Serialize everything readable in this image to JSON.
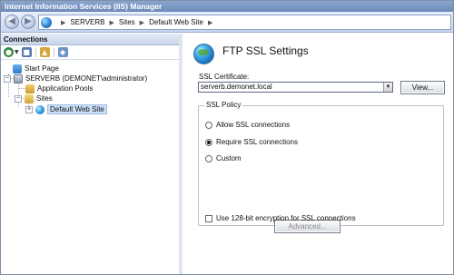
{
  "window": {
    "title": "Internet Information Services (IIS) Manager"
  },
  "addressbar": {
    "back_glyph": "◀",
    "forward_glyph": "▶",
    "crumbs": [
      "SERVERB",
      "Sites",
      "Default Web Site"
    ],
    "separator": "▶"
  },
  "connections": {
    "header": "Connections",
    "toolbar_icons": [
      "connect-icon",
      "save-icon",
      "up-icon",
      "rule-icon"
    ],
    "tree": {
      "start_page": "Start Page",
      "server": "SERVERB (DEMONET\\administrator)",
      "application_pools": "Application Pools",
      "sites": "Sites",
      "default_web_site": "Default Web Site",
      "expand_minus": "−",
      "expand_plus": "+"
    }
  },
  "feature": {
    "title": "FTP SSL Settings",
    "ssl_certificate_label": "SSL Certificate:",
    "ssl_certificate_value": "serverb.demonet.local",
    "dropdown_glyph": "▼",
    "view_button": "View...",
    "ssl_policy": {
      "title": "SSL Policy",
      "allow_label": "Allow SSL connections",
      "require_label": "Require SSL connections",
      "custom_label": "Custom",
      "advanced_button": "Advanced...",
      "selected": "require",
      "encryption_label": "Use 128-bit encryption for SSL connections",
      "encryption_checked": false
    }
  },
  "colors": {
    "titlebar": "#7d98c6",
    "selection": "#cde0f7",
    "pane_divider": "#dfe5ee"
  }
}
